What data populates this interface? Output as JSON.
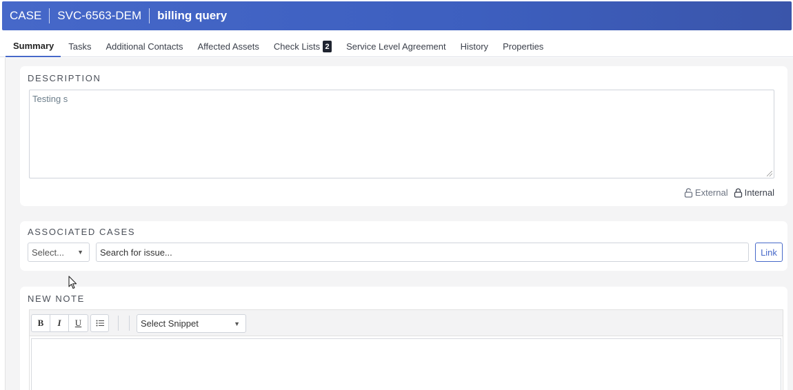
{
  "header": {
    "type_label": "CASE",
    "case_id": "SVC-6563-DEM",
    "title": "billing query",
    "gradient_start": "#4668c9",
    "gradient_end": "#3a55aa"
  },
  "tabs": [
    {
      "label": "Summary",
      "active": true
    },
    {
      "label": "Tasks"
    },
    {
      "label": "Additional Contacts"
    },
    {
      "label": "Affected Assets"
    },
    {
      "label": "Check Lists",
      "badge": "2"
    },
    {
      "label": "Service Level Agreement"
    },
    {
      "label": "History"
    },
    {
      "label": "Properties"
    }
  ],
  "description": {
    "heading": "DESCRIPTION",
    "value": "Testing s",
    "visibility": {
      "external_label": "External",
      "internal_label": "Internal",
      "external_icon": "unlock-icon",
      "internal_icon": "lock-icon"
    }
  },
  "associated_cases": {
    "heading": "ASSOCIATED CASES",
    "select_value": "Select...",
    "search_value": "Search for issue...",
    "link_label": "Link"
  },
  "new_note": {
    "heading": "NEW NOTE",
    "toolbar": {
      "bold": "B",
      "italic": "I",
      "underline": "U",
      "list_icon": "list-icon",
      "snippet_value": "Select Snippet"
    }
  },
  "colors": {
    "accent": "#4668c9",
    "badge_bg": "#1f2430",
    "content_bg": "#f4f4f5"
  }
}
